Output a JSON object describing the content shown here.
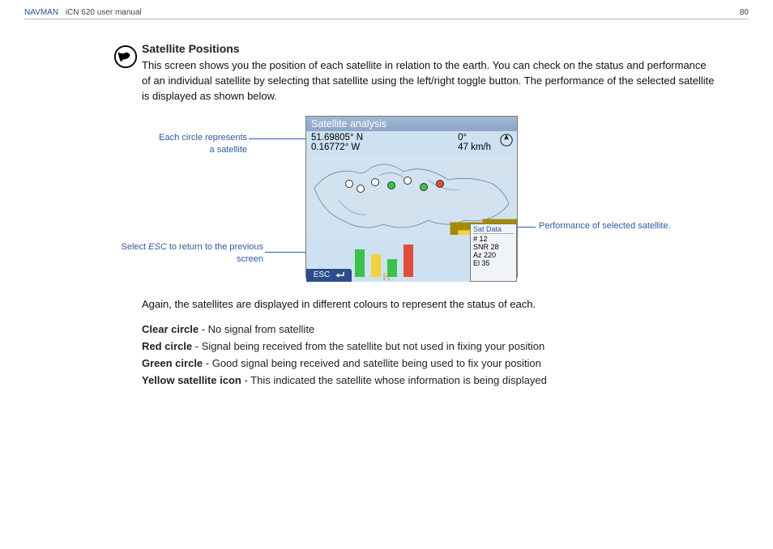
{
  "header": {
    "brand": "NAVMAN",
    "doc": "iCN 620 user manual",
    "page": "80"
  },
  "section": {
    "title": "Satellite Positions",
    "intro": "This screen shows you the position of each satellite in relation to the earth. You can check on the status and performance of an individual satellite by selecting that satellite using the left/right toggle button. The performance of the selected satellite is displayed as shown below.",
    "after_image": "Again, the satellites are displayed in different colours to represent the status of each.",
    "legend": [
      {
        "label": "Clear circle",
        "desc": " - No signal from satellite"
      },
      {
        "label": "Red circle",
        "desc": " - Signal being received from the satellite but not used in fixing your position"
      },
      {
        "label": "Green circle",
        "desc": " - Good signal being received and satellite being used to fix your position"
      },
      {
        "label": "Yellow satellite icon",
        "desc": " - This indicated the satellite whose information is being displayed"
      }
    ]
  },
  "callouts": {
    "left1": "Each circle represents a satellite",
    "left2_a": "Select ",
    "left2_b": "ESC",
    "left2_c": " to return to the previous screen",
    "right": "Performance of selected satellite."
  },
  "device": {
    "title": "Satellite analysis",
    "lat": "51.69805° N",
    "lon": "0.16772° W",
    "heading": "0°",
    "speed": "47 km/h",
    "esc": "ESC",
    "sat_data": {
      "hdr": "Sat Data",
      "id": "# 12",
      "snr": "SNR 28",
      "az": "Az 220",
      "el": "El 35"
    }
  }
}
